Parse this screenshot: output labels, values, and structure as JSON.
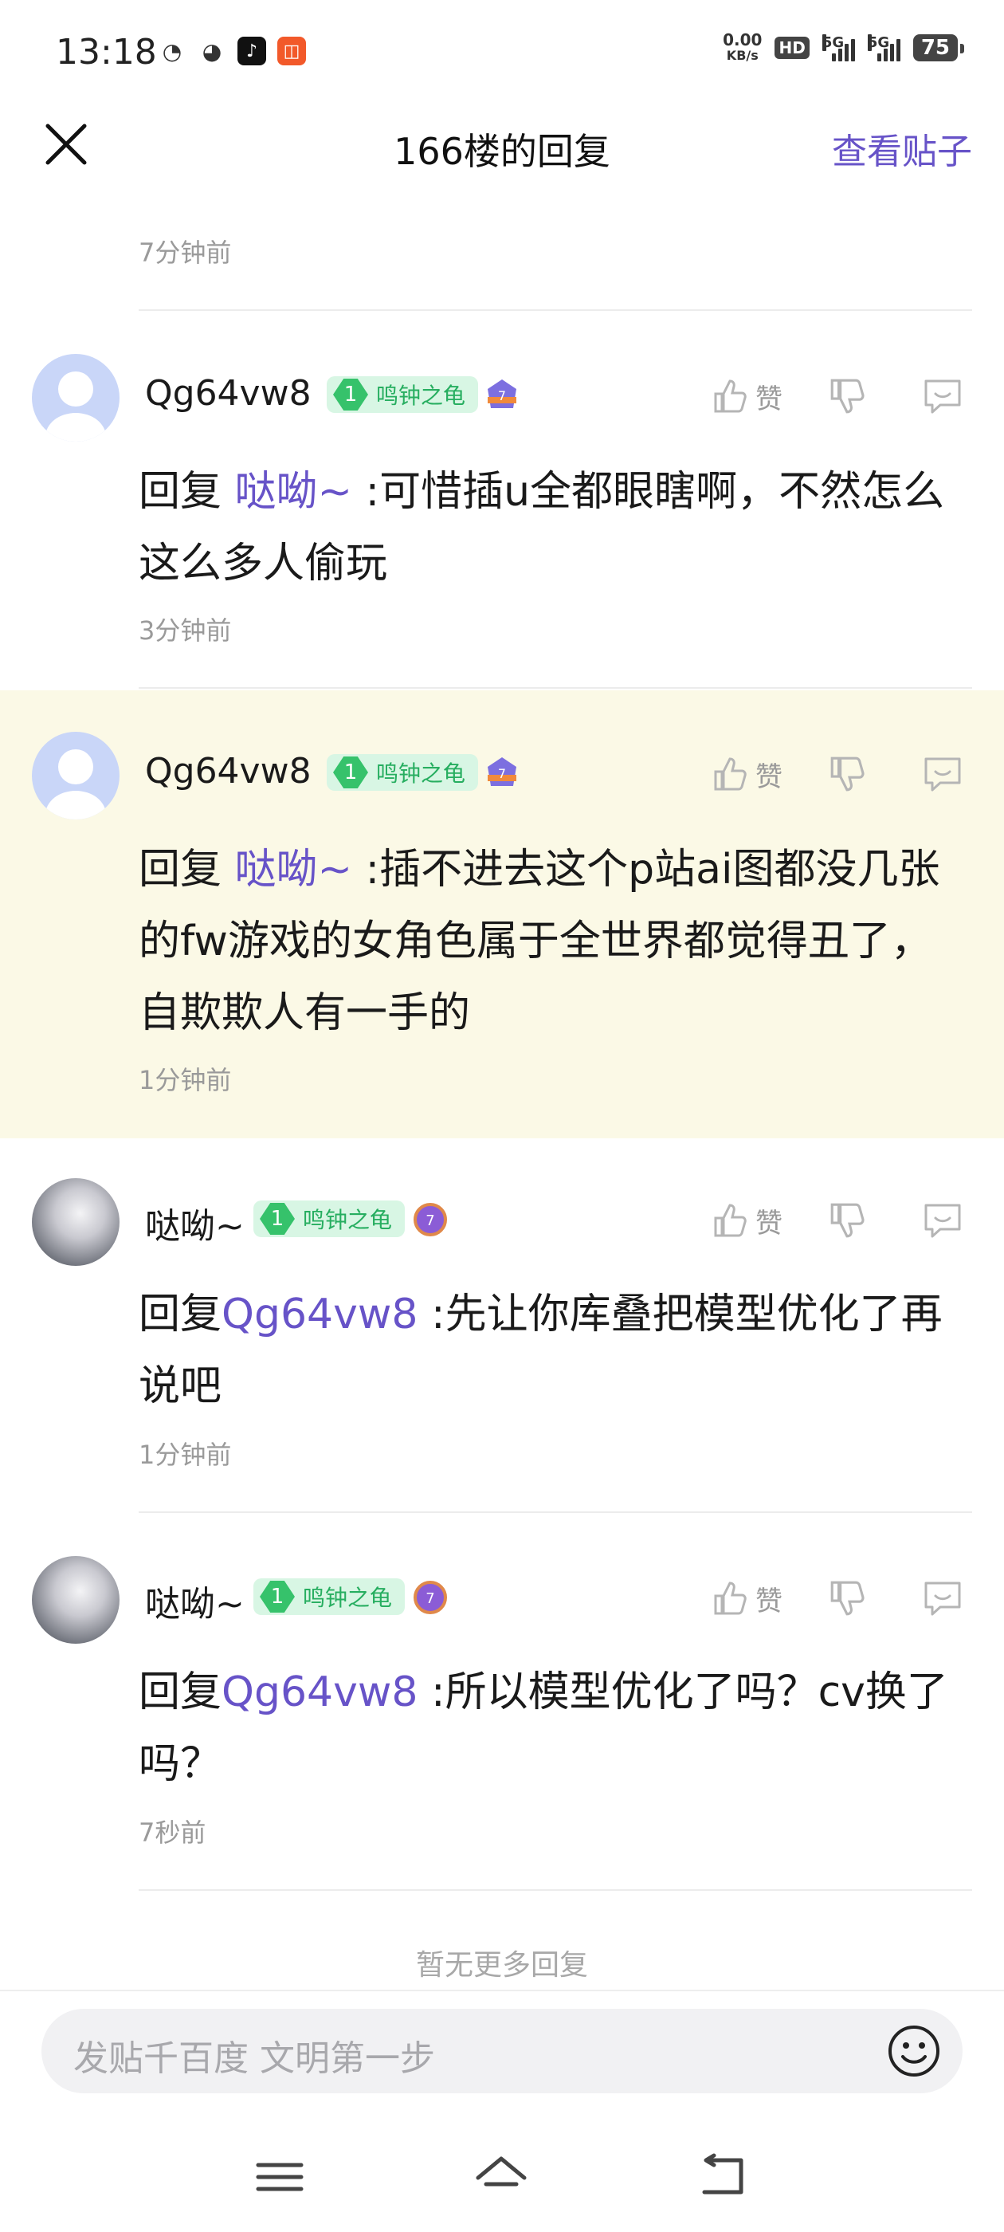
{
  "status_bar": {
    "time": "13:18",
    "net_speed_value": "0.00",
    "net_speed_unit": "KB/s",
    "hd_label": "HD",
    "sim1_label": "5G",
    "sim2_label": "5G",
    "battery": "75"
  },
  "header": {
    "title": "166楼的回复",
    "view_post": "查看贴子"
  },
  "fragment": {
    "time": "7分钟前"
  },
  "replies": [
    {
      "username": "Qg64vw8",
      "level": "1",
      "level_title": "鸣钟之龟",
      "badge": "7",
      "reply_prefix": "回复",
      "mention": "哒呦~",
      "text": ":可惜插u全都眼瞎啊，不然怎么这么多人偷玩",
      "time": "3分钟前",
      "like_label": "赞"
    },
    {
      "username": "Qg64vw8",
      "level": "1",
      "level_title": "鸣钟之龟",
      "badge": "7",
      "reply_prefix": "回复",
      "mention": "哒呦~",
      "text": ":插不进去这个p站ai图都没几张的fw游戏的女角色属于全世界都觉得丑了，自欺欺人有一手的",
      "time": "1分钟前",
      "like_label": "赞"
    },
    {
      "username": "哒呦~",
      "level": "1",
      "level_title": "鸣钟之龟",
      "badge": "7",
      "reply_prefix": "回复",
      "mention": "Qg64vw8",
      "text": ":先让你库叠把模型优化了再说吧",
      "time": "1分钟前",
      "like_label": "赞"
    },
    {
      "username": "哒呦~",
      "level": "1",
      "level_title": "鸣钟之龟",
      "badge": "7",
      "reply_prefix": "回复",
      "mention": "Qg64vw8",
      "text": ":所以模型优化了吗？cv换了吗？",
      "time": "7秒前",
      "like_label": "赞"
    }
  ],
  "no_more": "暂无更多回复",
  "compose": {
    "placeholder": "发贴千百度 文明第一步"
  },
  "icons": [
    "close-icon",
    "like-icon",
    "dislike-icon",
    "comment-icon",
    "emoji-icon",
    "menu-icon",
    "home-icon",
    "back-icon"
  ],
  "colors": {
    "accent": "#6753c8",
    "level_green": "#36c26b",
    "highlight_bg": "#fbf9e6"
  }
}
